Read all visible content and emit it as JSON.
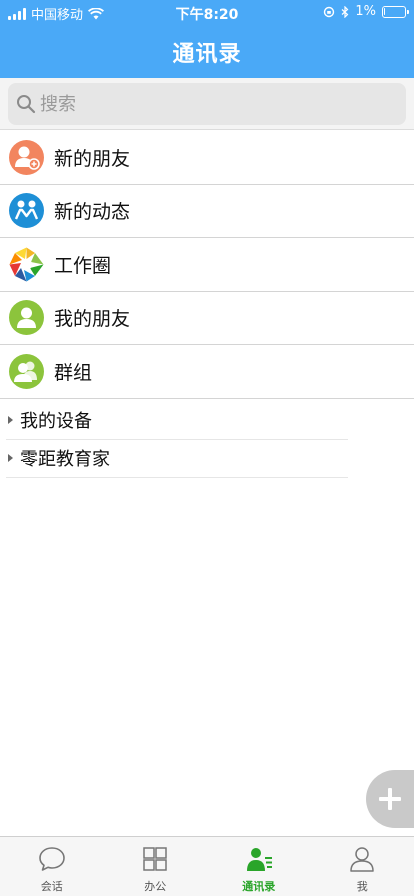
{
  "status_bar": {
    "carrier": "中国移动",
    "time": "下午8:20",
    "battery": "1%",
    "battery_level": 0.01
  },
  "header": {
    "title": "通讯录"
  },
  "search": {
    "placeholder": "搜索"
  },
  "contacts": [
    {
      "label": "新的朋友",
      "icon": "user-plus-icon",
      "color": "#f2855f"
    },
    {
      "label": "新的动态",
      "icon": "people-icon",
      "color": "#1e8fd6"
    },
    {
      "label": "工作圈",
      "icon": "aperture-icon",
      "color": "#ffffff"
    },
    {
      "label": "我的朋友",
      "icon": "user-icon",
      "color": "#8cc43c"
    },
    {
      "label": "群组",
      "icon": "group-icon",
      "color": "#8cc43c"
    }
  ],
  "groups": [
    {
      "label": "我的设备"
    },
    {
      "label": "零距教育家"
    }
  ],
  "tabs": [
    {
      "label": "会话",
      "icon": "chat-bubble-icon",
      "active": false
    },
    {
      "label": "办公",
      "icon": "grid-icon",
      "active": false
    },
    {
      "label": "通讯录",
      "icon": "contacts-icon",
      "active": true
    },
    {
      "label": "我",
      "icon": "person-outline-icon",
      "active": false
    }
  ],
  "colors": {
    "header_bg": "#4aa9f7",
    "active_tab": "#2aa52a",
    "fab_bg": "#c9c9c9"
  }
}
